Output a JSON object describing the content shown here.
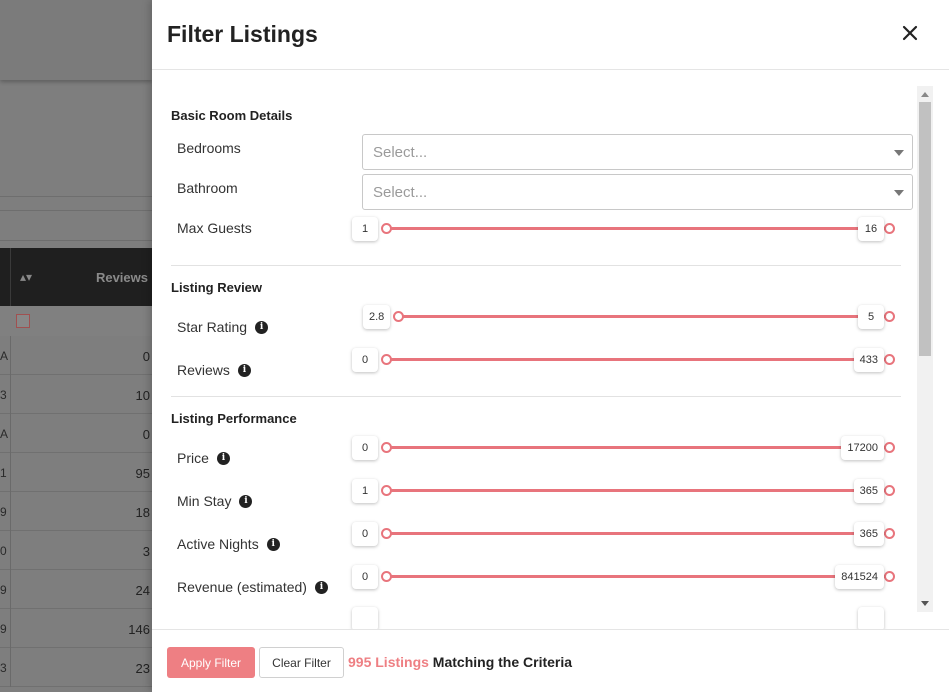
{
  "background": {
    "table_header_label": "Reviews",
    "rows": [
      {
        "left": "A",
        "value": "0"
      },
      {
        "left": "3",
        "value": "10"
      },
      {
        "left": "A",
        "value": "0"
      },
      {
        "left": "1",
        "value": "95"
      },
      {
        "left": "9",
        "value": "18"
      },
      {
        "left": "0",
        "value": "3"
      },
      {
        "left": "9",
        "value": "24"
      },
      {
        "left": "9",
        "value": "146"
      },
      {
        "left": "3",
        "value": "23"
      }
    ]
  },
  "modal": {
    "title": "Filter Listings",
    "sections": {
      "basic": {
        "title": "Basic Room Details",
        "bedrooms_label": "Bedrooms",
        "bedrooms_placeholder": "Select...",
        "bathroom_label": "Bathroom",
        "bathroom_placeholder": "Select...",
        "max_guests_label": "Max Guests",
        "max_guests_min": "1",
        "max_guests_max": "16"
      },
      "review": {
        "title": "Listing Review",
        "star_rating_label": "Star Rating",
        "star_rating_min": "2.8",
        "star_rating_max": "5",
        "reviews_label": "Reviews",
        "reviews_min": "0",
        "reviews_max": "433"
      },
      "performance": {
        "title": "Listing Performance",
        "price_label": "Price",
        "price_min": "0",
        "price_max": "17200",
        "min_stay_label": "Min Stay",
        "min_stay_min": "1",
        "min_stay_max": "365",
        "active_nights_label": "Active Nights",
        "active_nights_min": "0",
        "active_nights_max": "365",
        "revenue_label": "Revenue (estimated)",
        "revenue_min": "0",
        "revenue_max": "841524"
      }
    },
    "footer": {
      "apply_label": "Apply Filter",
      "clear_label": "Clear Filter",
      "result_count": "995 Listings",
      "result_suffix": " Matching the Criteria"
    }
  },
  "colors": {
    "accent": "#ee7f83",
    "slider": "#e8747c"
  },
  "icons": {
    "close": "close-icon",
    "info": "info-icon",
    "caret": "chevron-down-icon"
  }
}
